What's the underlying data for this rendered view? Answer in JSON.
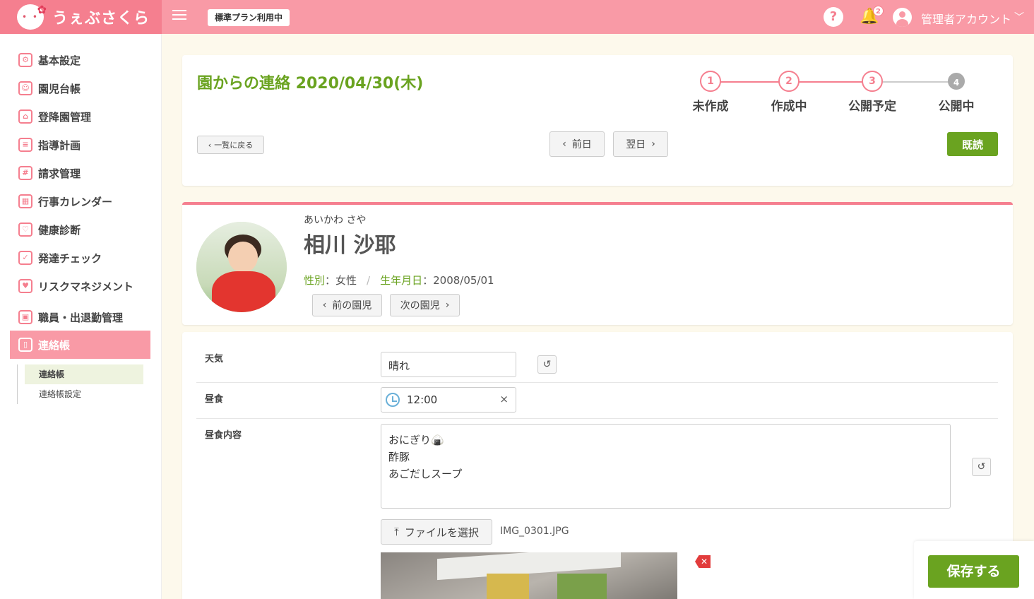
{
  "header": {
    "logo_text": "うぇぶさくら",
    "plan_badge": "標準プラン利用中",
    "notification_count": "2",
    "user_name": "管理者アカウント"
  },
  "sidebar": {
    "items": [
      {
        "label": "基本設定",
        "icon": "gear-icon"
      },
      {
        "label": "園児台帳",
        "icon": "child-icon"
      },
      {
        "label": "登降園管理",
        "icon": "school-icon"
      },
      {
        "label": "指導計画",
        "icon": "notebook-icon"
      },
      {
        "label": "請求管理",
        "icon": "calculator-icon"
      },
      {
        "label": "行事カレンダー",
        "icon": "calendar-icon"
      },
      {
        "label": "健康診断",
        "icon": "stethoscope-icon"
      },
      {
        "label": "発達チェック",
        "icon": "checklist-icon"
      },
      {
        "label": "リスクマネジメント",
        "icon": "hands-icon"
      },
      {
        "label": "職員・出退勤管理",
        "icon": "briefcase-icon"
      },
      {
        "label": "連絡帳",
        "icon": "book-icon"
      }
    ],
    "sub_items": [
      "連絡帳",
      "連絡帳設定"
    ]
  },
  "title_card": {
    "title": "園からの連絡 2020/04/30(木)",
    "steps": [
      {
        "num": "1",
        "label": "未作成"
      },
      {
        "num": "2",
        "label": "作成中"
      },
      {
        "num": "3",
        "label": "公開予定"
      },
      {
        "num": "4",
        "label": "公開中"
      }
    ],
    "back_label": "一覧に戻る",
    "prev_day_label": "前日",
    "next_day_label": "翌日",
    "read_label": "既読"
  },
  "child": {
    "kana": "あいかわ さや",
    "name": "相川 沙耶",
    "gender_key": "性別",
    "gender_value": "：女性",
    "sep": "/",
    "birth_key": "生年月日",
    "birth_value": "：2008/05/01",
    "prev_label": "前の園児",
    "next_label": "次の園児"
  },
  "form": {
    "weather_label": "天気",
    "weather_value": "晴れ",
    "lunch_label": "昼食",
    "lunch_time": "12:00",
    "lunch_content_label": "昼食内容",
    "lunch_content_lines": [
      "おにぎり🍙",
      "酢豚",
      "あごだしスープ"
    ],
    "file_button_label": "ファイルを選択",
    "file_name": "IMG_0301.JPG"
  },
  "save_label": "保存する",
  "colors": {
    "accent_pink": "#f57f8f",
    "header_pink": "#f99aa6",
    "green": "#6aa320"
  }
}
